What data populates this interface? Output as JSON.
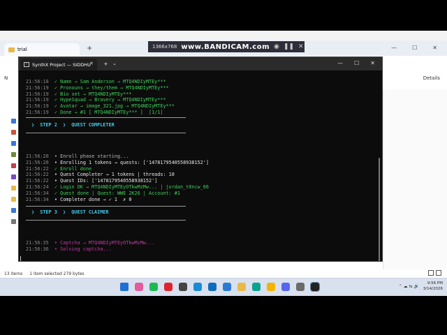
{
  "bandicam": {
    "resolution": "1366x768",
    "brand": "www.BANDICAM.com",
    "icons": [
      "camera-icon",
      "pause-icon",
      "stop-icon"
    ]
  },
  "explorer": {
    "tab_title": "trial",
    "new_button": "N",
    "details_button": "Details",
    "status_items": "13 items",
    "status_selected": "1 item selected  279 bytes",
    "window_controls": [
      "—",
      "☐",
      "✕"
    ]
  },
  "terminal": {
    "tab_title": "SynthX Project — SIDDHU",
    "new_tab": "+",
    "dropdown": "⌄",
    "window_controls": [
      "—",
      "☐",
      "✕"
    ],
    "tab_close": "✕",
    "block1": [
      {
        "time": "21:56:18",
        "mark": "✓",
        "text": "Name → Sam Anderson → MTQ4NDIyMTEy***"
      },
      {
        "time": "21:56:19",
        "mark": "✓",
        "text": "Pronouns → they/them → MTQ4NDIyMTEy***"
      },
      {
        "time": "21:56:19",
        "mark": "✓",
        "text": "Bio set → MTQ4NDIyMTEy***"
      },
      {
        "time": "21:56:19",
        "mark": "✓",
        "text": "HypeSquad → Bravery → MTQ4NDIyMTEy***"
      },
      {
        "time": "21:56:19",
        "mark": "✓",
        "text": "Avatar → image_321.jpg → MTQ4NDIyMTEy***"
      },
      {
        "time": "21:56:19",
        "mark": "✓",
        "text": "Done → #1 [ MTQ4NDIyMTEy*** ]  [1/1]"
      }
    ],
    "step2": "❯  STEP 2  ❯  QUEST COMPLETER",
    "block2": [
      {
        "time": "21:56:20",
        "mark": "•",
        "text": "Enroll phase starting...",
        "tone": "dim"
      },
      {
        "time": "21:56:20",
        "mark": "•",
        "text": "Enrolling 1 tokens → quests: ['1478179540558938152']",
        "tone": "white"
      },
      {
        "time": "21:56:22",
        "mark": "✓",
        "text": "Enroll done",
        "tone": "green"
      },
      {
        "time": "21:56:22",
        "mark": "•",
        "text": "Quest Completer → 1 tokens | threads: 10",
        "tone": "white"
      },
      {
        "time": "21:56:22",
        "mark": "•",
        "text": "Quest IDs: ['1478179540558938152']",
        "tone": "white"
      },
      {
        "time": "21:56:24",
        "mark": "✓",
        "text": "Login OK → MTQ4NDIyMTEyOTkwMzMw... | jordan_t0ncw_66",
        "tone": "green"
      },
      {
        "time": "21:56:34",
        "mark": "✓",
        "text": "Quest done | Quest: WWE 2K26 | Account: #1",
        "tone": "green"
      },
      {
        "time": "21:56:34",
        "mark": "•",
        "text": "Completer done → ✓ 1  ✗ 0",
        "tone": "white"
      }
    ],
    "step3": "❯  STEP 3  ❯  QUEST CLAIMER",
    "block3": [
      {
        "time": "21:56:35",
        "mark": "•",
        "text": "Captcha → MTQ4NDIyMTEyOTkwMzMw...",
        "tone": "magenta"
      },
      {
        "time": "21:56:36",
        "mark": "•",
        "text": "Solving captcha...",
        "tone": "magenta"
      }
    ]
  },
  "taskbar": {
    "apps": [
      "start-icon",
      "copilot-icon",
      "spotify-icon",
      "opera-icon",
      "box-icon",
      "edge-icon",
      "outlook-icon",
      "vscode-icon",
      "files-icon",
      "edge-dev-icon",
      "chrome-icon",
      "discord-icon",
      "settings-icon",
      "terminal-icon"
    ],
    "time": "9:56 PM",
    "date": "3/14/2026"
  },
  "colors": {
    "terminal_bg": "#0c0c0c",
    "success": "#3fd15a",
    "step_header": "#49c7e8",
    "captcha": "#c23aa5"
  }
}
